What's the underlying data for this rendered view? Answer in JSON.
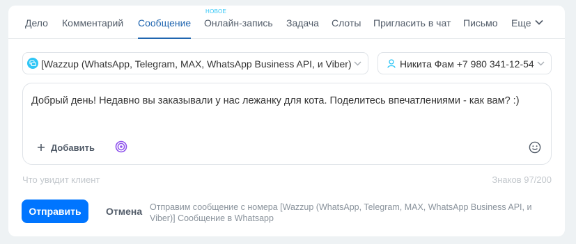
{
  "tabs": {
    "items": [
      {
        "label": "Дело",
        "active": false
      },
      {
        "label": "Комментарий",
        "active": false
      },
      {
        "label": "Сообщение",
        "active": true
      },
      {
        "label": "Онлайн-запись",
        "active": false,
        "badge": "НОВОЕ"
      },
      {
        "label": "Задача",
        "active": false
      },
      {
        "label": "Слоты",
        "active": false
      },
      {
        "label": "Пригласить в чат",
        "active": false
      },
      {
        "label": "Письмо",
        "active": false
      },
      {
        "label": "Еще",
        "active": false
      }
    ],
    "more_icon": "chevron-down-icon"
  },
  "channel_select": {
    "value": "[Wazzup (WhatsApp, Telegram, MAX, WhatsApp Business API, и Viber)...",
    "icon": "channel-chat-icon"
  },
  "recipient_select": {
    "value": "Никита Фам +7 980 341-12-54",
    "icon": "person-icon"
  },
  "composer": {
    "message": "Добрый день! Недавно вы заказывали у нас лежанку для кота. Поделитесь впечатлениями - как вам? :)",
    "add_label": "Добавить",
    "copilot_icon": "copilot-icon",
    "emoji_icon": "smile-icon"
  },
  "preview_hint": "Что увидит клиент",
  "char_counter": "Знаков 97/200",
  "actions": {
    "send_label": "Отправить",
    "cancel_label": "Отмена",
    "footnote": "Отправим сообщение с номера [Wazzup (WhatsApp, Telegram, MAX, WhatsApp Business API, и Viber)] Сообщение в Whatsapp"
  },
  "colors": {
    "accent": "#2066b0",
    "send_button": "#0075ff",
    "badge": "#2fc6f6",
    "copilot": "#8e52ec",
    "channel_icon": "#2fc6f6"
  }
}
